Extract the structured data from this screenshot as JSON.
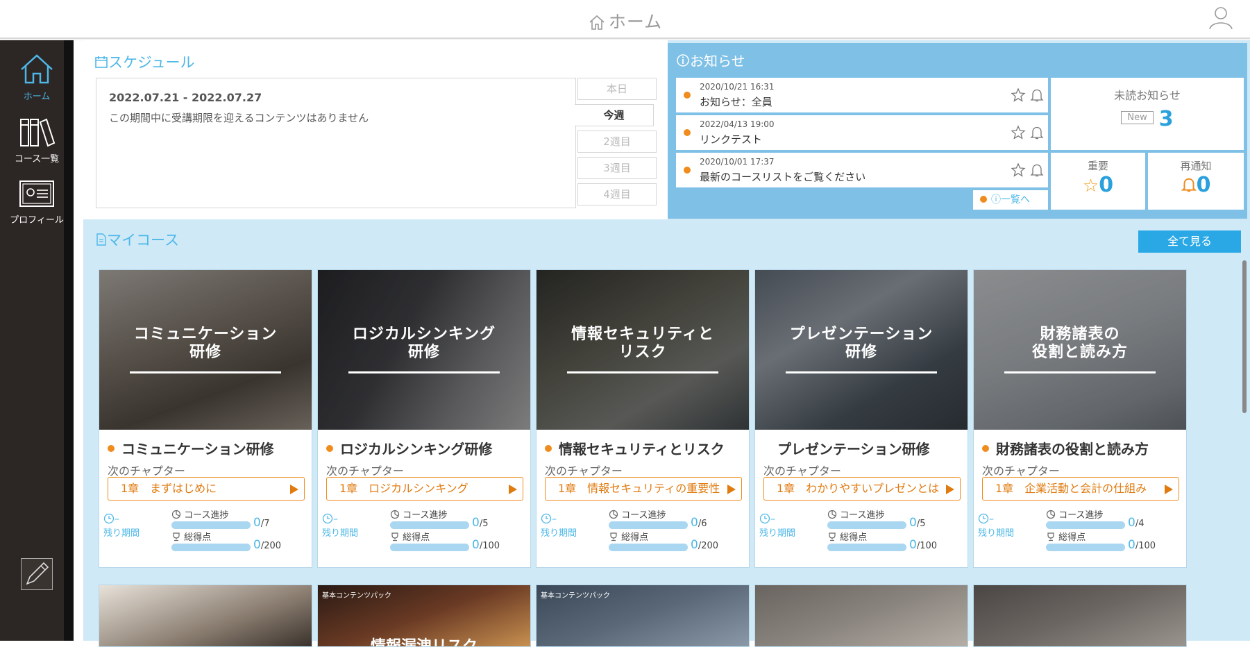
{
  "header": {
    "title": "ホーム"
  },
  "sidebar": {
    "items": [
      {
        "label": "ホーム"
      },
      {
        "label": "コース一覧"
      },
      {
        "label": "プロフィール"
      }
    ]
  },
  "schedule": {
    "title": "スケジュール",
    "range": "2022.07.21 - 2022.07.27",
    "message": "この期間中に受講期限を迎えるコンテンツはありません",
    "tabs": [
      "本日",
      "今週",
      "2週目",
      "3週目",
      "4週目"
    ],
    "active_tab": "今週"
  },
  "notice": {
    "title": "お知らせ",
    "items": [
      {
        "date": "2020/10/21 16:31",
        "text": "お知らせ：全員"
      },
      {
        "date": "2022/04/13 19:00",
        "text": "リンクテスト"
      },
      {
        "date": "2020/10/01 17:37",
        "text": "最新のコースリストをご覧ください"
      }
    ],
    "list_link": "一覧へ",
    "unread_label": "未読お知らせ",
    "new_badge": "New",
    "unread_count": "3",
    "important_label": "重要",
    "important_count": "0",
    "renotify_label": "再通知",
    "renotify_count": "0",
    "accent": "#f08c1e",
    "panel_color": "#7fc0e6"
  },
  "mycourse": {
    "title": "マイコース",
    "all_button": "全て見る",
    "next_label": "次のチャプター",
    "progress_label": "コース進捗",
    "score_label": "総得点",
    "remaining_label": "残り期間",
    "remaining_value": "–",
    "courses": [
      {
        "img_title_1": "コミュニケーション",
        "img_title_2": "研修",
        "name": "コミュニケーション研修",
        "dot": true,
        "chapter": "1章　まずはじめに",
        "progress": "0",
        "progress_total": "/7",
        "score": "0",
        "score_total": "/200"
      },
      {
        "img_title_1": "ロジカルシンキング",
        "img_title_2": "研修",
        "name": "ロジカルシンキング研修",
        "dot": true,
        "chapter": "1章　ロジカルシンキング",
        "progress": "0",
        "progress_total": "/5",
        "score": "0",
        "score_total": "/100"
      },
      {
        "img_title_1": "情報セキュリティと",
        "img_title_2": "リスク",
        "name": "情報セキュリティとリスク",
        "dot": true,
        "chapter": "1章　情報セキュリティの重要性",
        "progress": "0",
        "progress_total": "/6",
        "score": "0",
        "score_total": "/200"
      },
      {
        "img_title_1": "プレゼンテーション",
        "img_title_2": "研修",
        "name": "プレゼンテーション研修",
        "dot": false,
        "chapter": "1章　わかりやすいプレゼンとは",
        "progress": "0",
        "progress_total": "/5",
        "score": "0",
        "score_total": "/100"
      },
      {
        "img_title_1": "財務諸表の",
        "img_title_2": "役割と読み方",
        "name": "財務諸表の役割と読み方",
        "dot": true,
        "chapter": "1章　企業活動と会計の仕組み",
        "progress": "0",
        "progress_total": "/4",
        "score": "0",
        "score_total": "/100"
      }
    ],
    "row2": [
      {
        "tag": "",
        "title": ""
      },
      {
        "tag": "基本コンテンツパック",
        "title": "情報漏洩リスク"
      },
      {
        "tag": "基本コンテンツパック",
        "title": ""
      },
      {
        "tag": "",
        "title": ""
      },
      {
        "tag": "",
        "title": ""
      }
    ]
  }
}
